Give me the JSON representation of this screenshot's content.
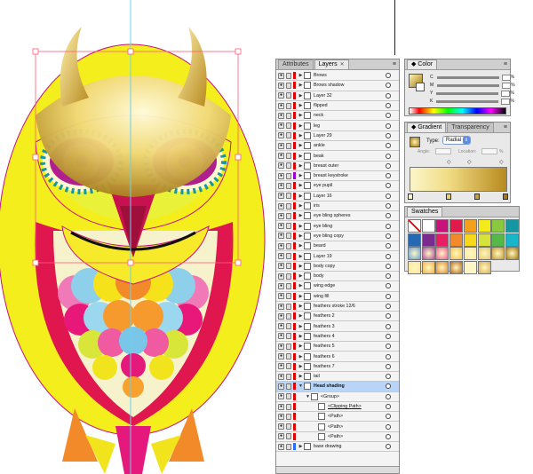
{
  "layers_panel": {
    "tabs": [
      "Attributes",
      "Layers"
    ],
    "active_tab": "Layers",
    "rows": [
      {
        "name": "Brows",
        "chip": "#e00000"
      },
      {
        "name": "Brows shadow",
        "chip": "#e00000"
      },
      {
        "name": "Layer 32",
        "chip": "#e00000"
      },
      {
        "name": "flipped",
        "chip": "#e00000"
      },
      {
        "name": "neck",
        "chip": "#e00000"
      },
      {
        "name": "leg",
        "chip": "#e00000"
      },
      {
        "name": "Layer 29",
        "chip": "#e00000"
      },
      {
        "name": "ankle",
        "chip": "#e00000"
      },
      {
        "name": "beak",
        "chip": "#e00000"
      },
      {
        "name": "breast outer",
        "chip": "#e00000"
      },
      {
        "name": "breast keystroke",
        "chip": "#9a00d0"
      },
      {
        "name": "eye pupil",
        "chip": "#e00000"
      },
      {
        "name": "Layer 16",
        "chip": "#e00000"
      },
      {
        "name": "iris",
        "chip": "#e00000"
      },
      {
        "name": "eye bling spheres",
        "chip": "#e00000"
      },
      {
        "name": "eye bling",
        "chip": "#e00000"
      },
      {
        "name": "eye bling copy",
        "chip": "#e00000"
      },
      {
        "name": "beard",
        "chip": "#e00000"
      },
      {
        "name": "Layer 19",
        "chip": "#e00000"
      },
      {
        "name": "body copy",
        "chip": "#e00000"
      },
      {
        "name": "body",
        "chip": "#e00000"
      },
      {
        "name": "wing edge",
        "chip": "#e00000"
      },
      {
        "name": "wing fill",
        "chip": "#e00000"
      },
      {
        "name": "feathers stroke 12/6",
        "chip": "#e00000"
      },
      {
        "name": "feathers 2",
        "chip": "#e00000"
      },
      {
        "name": "feathers 3",
        "chip": "#e00000"
      },
      {
        "name": "feathers 4",
        "chip": "#e00000"
      },
      {
        "name": "feathers 5",
        "chip": "#e00000"
      },
      {
        "name": "feathers 6",
        "chip": "#e00000"
      },
      {
        "name": "feathers 7",
        "chip": "#e00000"
      },
      {
        "name": "tail",
        "chip": "#e00000"
      },
      {
        "name": "Head shading",
        "chip": "#e00000",
        "selected": true,
        "expanded": true
      },
      {
        "name": "<Group>",
        "chip": "#e00000",
        "indent": 1,
        "expanded": true
      },
      {
        "name": "<Clipping Path>",
        "chip": "#e00000",
        "indent": 2,
        "underline": true
      },
      {
        "name": "<Path>",
        "chip": "#e00000",
        "indent": 2
      },
      {
        "name": "<Path>",
        "chip": "#e00000",
        "indent": 2
      },
      {
        "name": "<Path>",
        "chip": "#e00000",
        "indent": 2
      },
      {
        "name": "base drawing",
        "chip": "#2a6cff"
      }
    ]
  },
  "color_panel": {
    "tab": "Color",
    "channels": [
      {
        "label": "C",
        "unit": "%"
      },
      {
        "label": "M",
        "unit": "%"
      },
      {
        "label": "Y",
        "unit": "%"
      },
      {
        "label": "K",
        "unit": "%"
      }
    ]
  },
  "gradient_panel": {
    "tabs": [
      "Gradient",
      "Transparency"
    ],
    "type_label": "Type:",
    "type_value": "Radial",
    "angle_label": "Angle:",
    "location_label": "Location:",
    "location_unit": "%"
  },
  "swatches_panel": {
    "tab": "Swatches"
  },
  "colors": {
    "gold_light": "#fbf2b0",
    "gold_dark": "#a57a12",
    "magenta": "#e3157a",
    "yellow": "#f4ec1a",
    "teal": "#1596a0"
  }
}
